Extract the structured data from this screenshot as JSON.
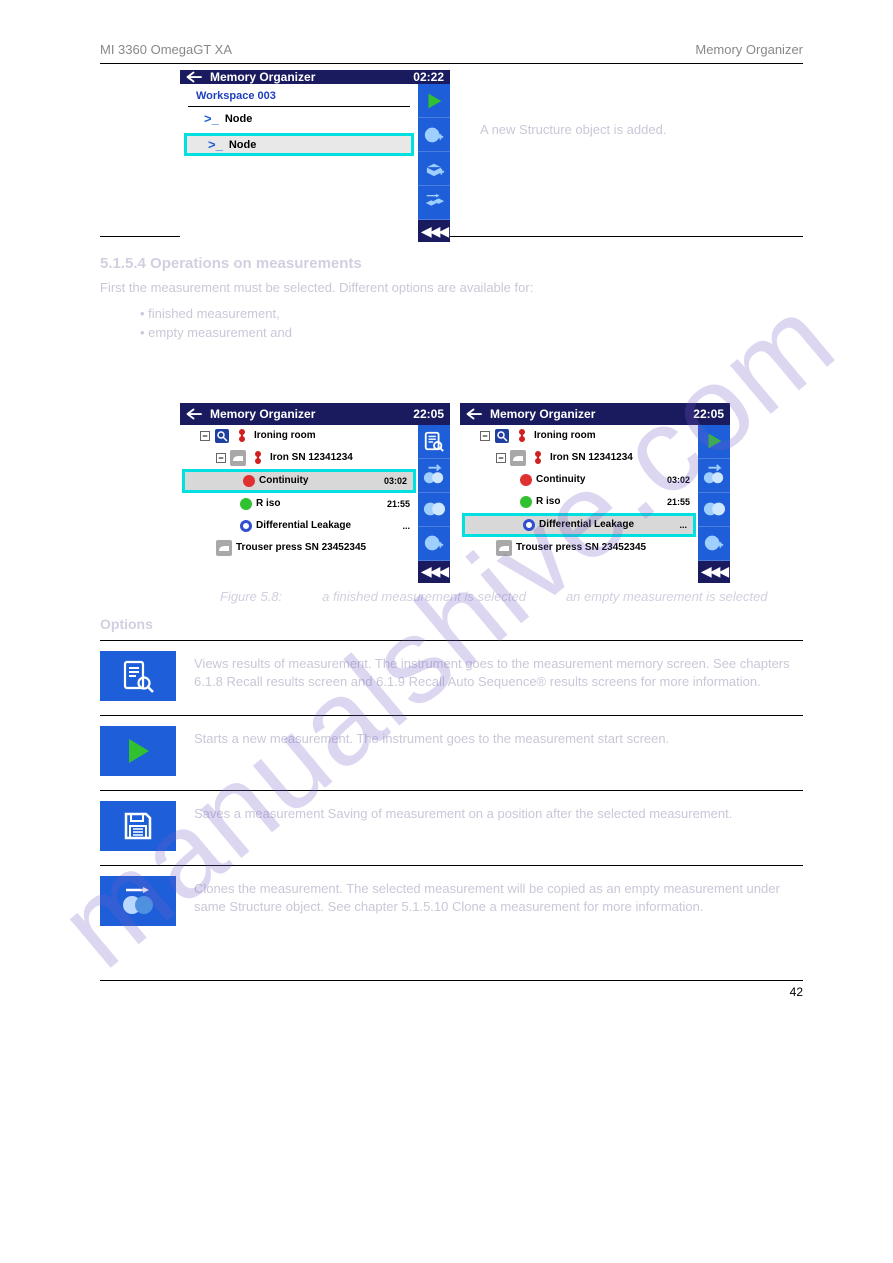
{
  "header": {
    "left": "MI 3360 OmegaGT XA",
    "right": "Memory Organizer"
  },
  "footer": {
    "page": "42"
  },
  "watermark": "manualshive.com",
  "screenshot1": {
    "title": "Memory Organizer",
    "time": "02:22",
    "workspace": "Workspace 003",
    "nodes": [
      "Node",
      "Node"
    ]
  },
  "screenshot1_caption": "A new Structure object is added.",
  "section_heading": "5.1.5.4 Operations on measurements",
  "section_intro": "First the measurement must be selected. Different options are available for:",
  "section_bullets": [
    "finished measurement,",
    "empty measurement and"
  ],
  "screenshot2": {
    "title": "Memory Organizer",
    "time": "22:05",
    "rows": {
      "r1": "Ironing room",
      "r2": "Iron SN 12341234",
      "r3_name": "Continuity",
      "r3_time": "03:02",
      "r4_name": "R iso",
      "r4_time": "21:55",
      "r5_name": "Differential Leakage",
      "r5_time": "...",
      "r6": "Trouser press SN 23452345"
    }
  },
  "fig_caption": {
    "num": "Figure 5.8:",
    "left": "a finished measurement is selected",
    "right": "an empty measurement is selected"
  },
  "options_heading": "Options",
  "options": {
    "view": "Views results of measurement.\nThe instrument goes to the measurement memory screen. See chapters 6.1.8 Recall results screen and 6.1.9 Recall Auto Sequence® results screens for more information.",
    "start": "Starts a new measurement.\nThe instrument goes to the measurement start screen.",
    "save": "Saves a measurement\nSaving of measurement on a position after the selected measurement.",
    "clone": "Clones the measurement.\nThe selected measurement will be copied as an empty measurement under same Structure object. See chapter 5.1.5.10 Clone a measurement for more information."
  }
}
